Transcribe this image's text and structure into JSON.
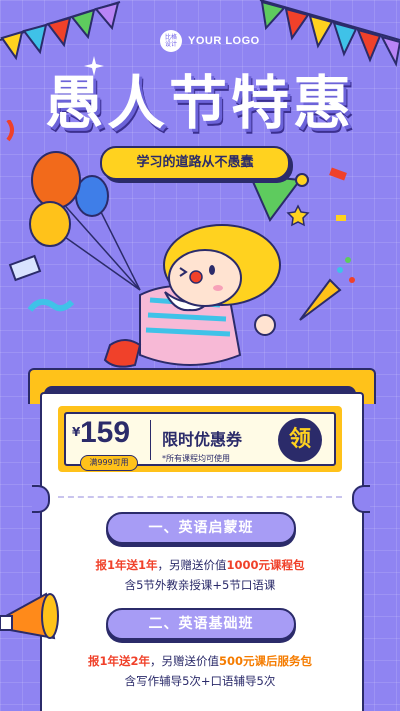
{
  "brand": {
    "logo_mark": "比格\n设计",
    "logo_text": "YOUR LOGO"
  },
  "headline": {
    "title": "愚人节特惠",
    "subtitle": "学习的道路从不愚蠢"
  },
  "coupon": {
    "currency": "¥",
    "price": "159",
    "condition": "满999可用",
    "title": "限时优惠券",
    "note": "*所有课程均可使用",
    "claim_label": "领"
  },
  "courses": [
    {
      "name": "一、英语启蒙班",
      "offer_highlight": "报1年送1年",
      "offer_middle": "，另赠送价值",
      "offer_bonus": "1000元课程包",
      "detail": "含5节外教亲授课+5节口语课"
    },
    {
      "name": "二、英语基础班",
      "offer_highlight": "报1年送2年",
      "offer_middle": "，另赠送价值",
      "offer_bonus": "500元课后服务包",
      "detail": "含写作辅导5次+口语辅导5次"
    }
  ],
  "colors": {
    "background": "#8f84f2",
    "accent_yellow": "#ffc21a",
    "navy": "#2b2b6a",
    "red": "#f0412a",
    "orange": "#f57c00"
  },
  "icons": [
    "balloon-icon",
    "party-hat-icon",
    "clown-mascot",
    "party-popper-icon",
    "megaphone-icon",
    "star-icon",
    "bunting-flags"
  ]
}
